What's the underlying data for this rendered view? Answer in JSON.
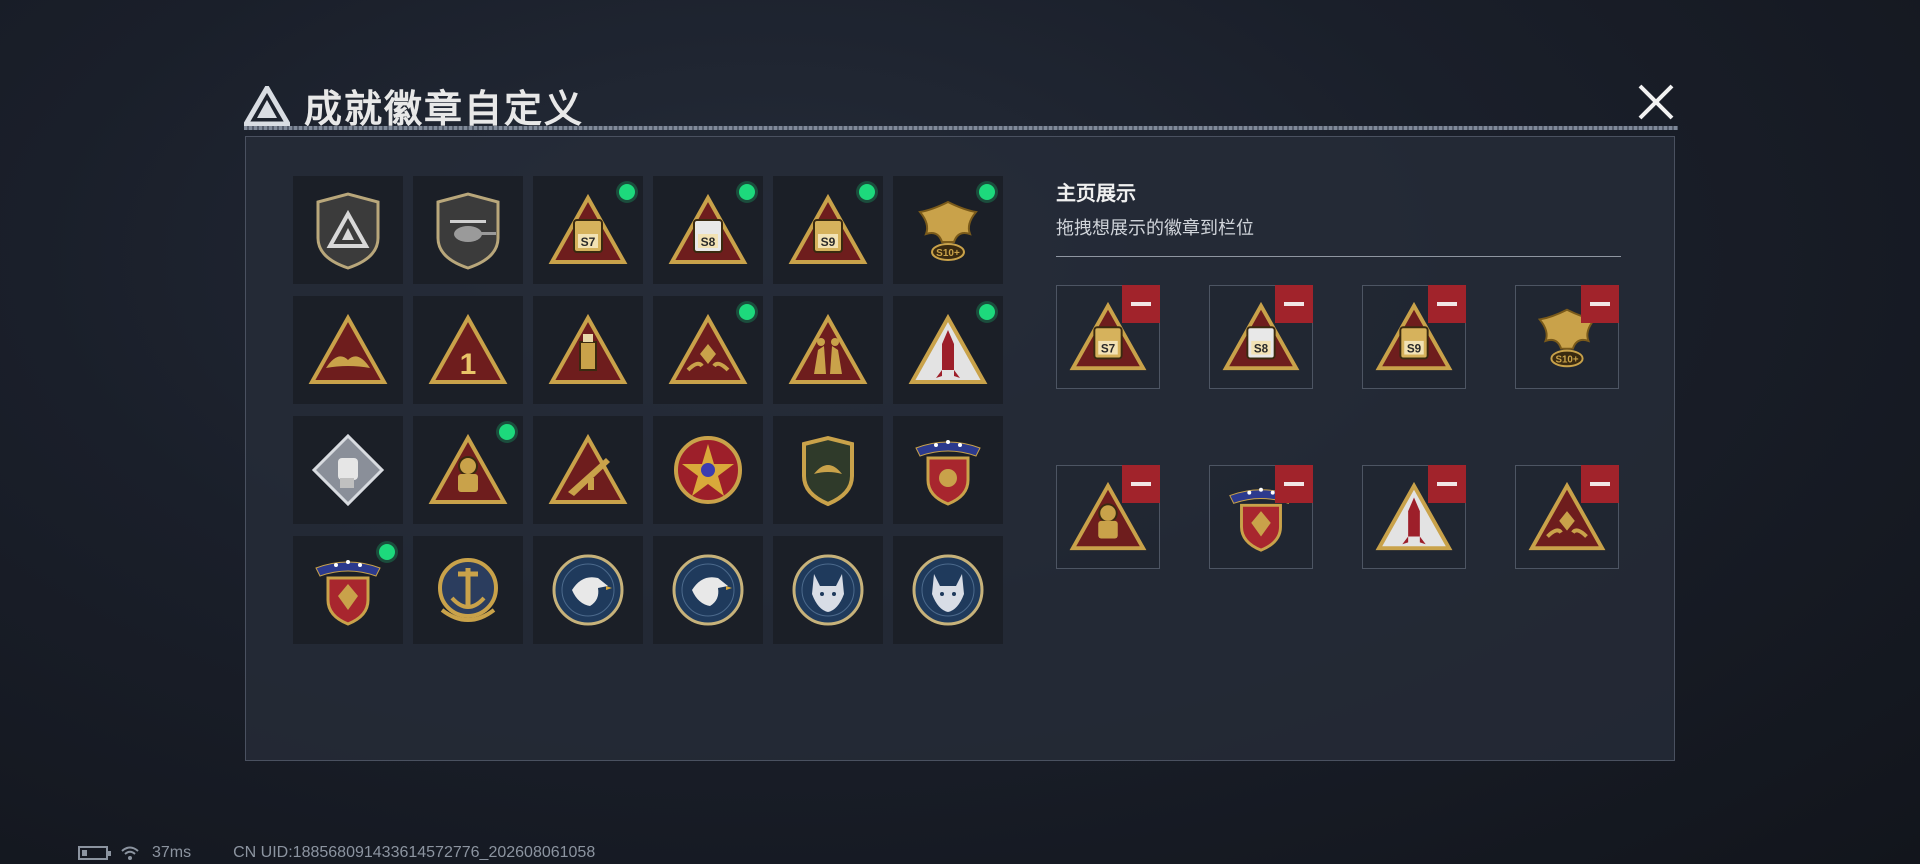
{
  "header": {
    "title": "成就徽章自定义"
  },
  "panel": {
    "side_title": "主页展示",
    "side_subtitle": "拖拽想展示的徽章到栏位"
  },
  "badges": [
    {
      "icon": "shield-logo-badge-icon",
      "new": false
    },
    {
      "icon": "helicopter-shield-badge-icon",
      "new": false
    },
    {
      "icon": "s7-badge-icon",
      "new": true,
      "label": "S7"
    },
    {
      "icon": "s8-badge-icon",
      "new": true,
      "label": "S8"
    },
    {
      "icon": "s9-badge-icon",
      "new": true,
      "label": "S9"
    },
    {
      "icon": "eagle-s10-badge-icon",
      "new": true,
      "label": "S10+"
    },
    {
      "icon": "wings-triangle-badge-icon",
      "new": false
    },
    {
      "icon": "number-one-badge-icon",
      "new": false,
      "label": "1"
    },
    {
      "icon": "usb-drive-badge-icon",
      "new": false
    },
    {
      "icon": "hands-gem-badge-icon",
      "new": true
    },
    {
      "icon": "soldiers-badge-icon",
      "new": false
    },
    {
      "icon": "rocket-badge-icon",
      "new": true
    },
    {
      "icon": "fist-diamond-badge-icon",
      "new": false
    },
    {
      "icon": "diver-badge-icon",
      "new": true
    },
    {
      "icon": "rifle-badge-icon",
      "new": false
    },
    {
      "icon": "star-medal-badge-icon",
      "new": false
    },
    {
      "icon": "wing-shield-badge-icon",
      "new": false
    },
    {
      "icon": "banner-shield-badge-icon",
      "new": false
    },
    {
      "icon": "banner-gem-shield-badge-icon",
      "new": true
    },
    {
      "icon": "anchor-wreath-badge-icon",
      "new": false
    },
    {
      "icon": "eagle-coin-badge-icon",
      "new": false
    },
    {
      "icon": "eagle-coin-badge-icon",
      "new": false
    },
    {
      "icon": "wolf-coin-badge-icon",
      "new": false
    },
    {
      "icon": "wolf-coin-badge-icon",
      "new": false
    }
  ],
  "slots": [
    {
      "icon": "s7-badge-icon",
      "label": "S7"
    },
    {
      "icon": "s8-badge-icon",
      "label": "S8"
    },
    {
      "icon": "s9-badge-icon",
      "label": "S9"
    },
    {
      "icon": "eagle-s10-badge-icon",
      "label": "S10+"
    },
    {
      "icon": "diver-badge-icon"
    },
    {
      "icon": "banner-gem-shield-badge-icon"
    },
    {
      "icon": "rocket-badge-icon"
    },
    {
      "icon": "hands-gem-badge-icon"
    }
  ],
  "status": {
    "ping": "37ms",
    "uid": "CN UID:18856809143361457277​6_202608061058"
  },
  "colors": {
    "accent_green": "#1dd97c",
    "remove_red": "#a1232b",
    "gold": "#c9a24a",
    "maroon": "#6e1d1d"
  }
}
